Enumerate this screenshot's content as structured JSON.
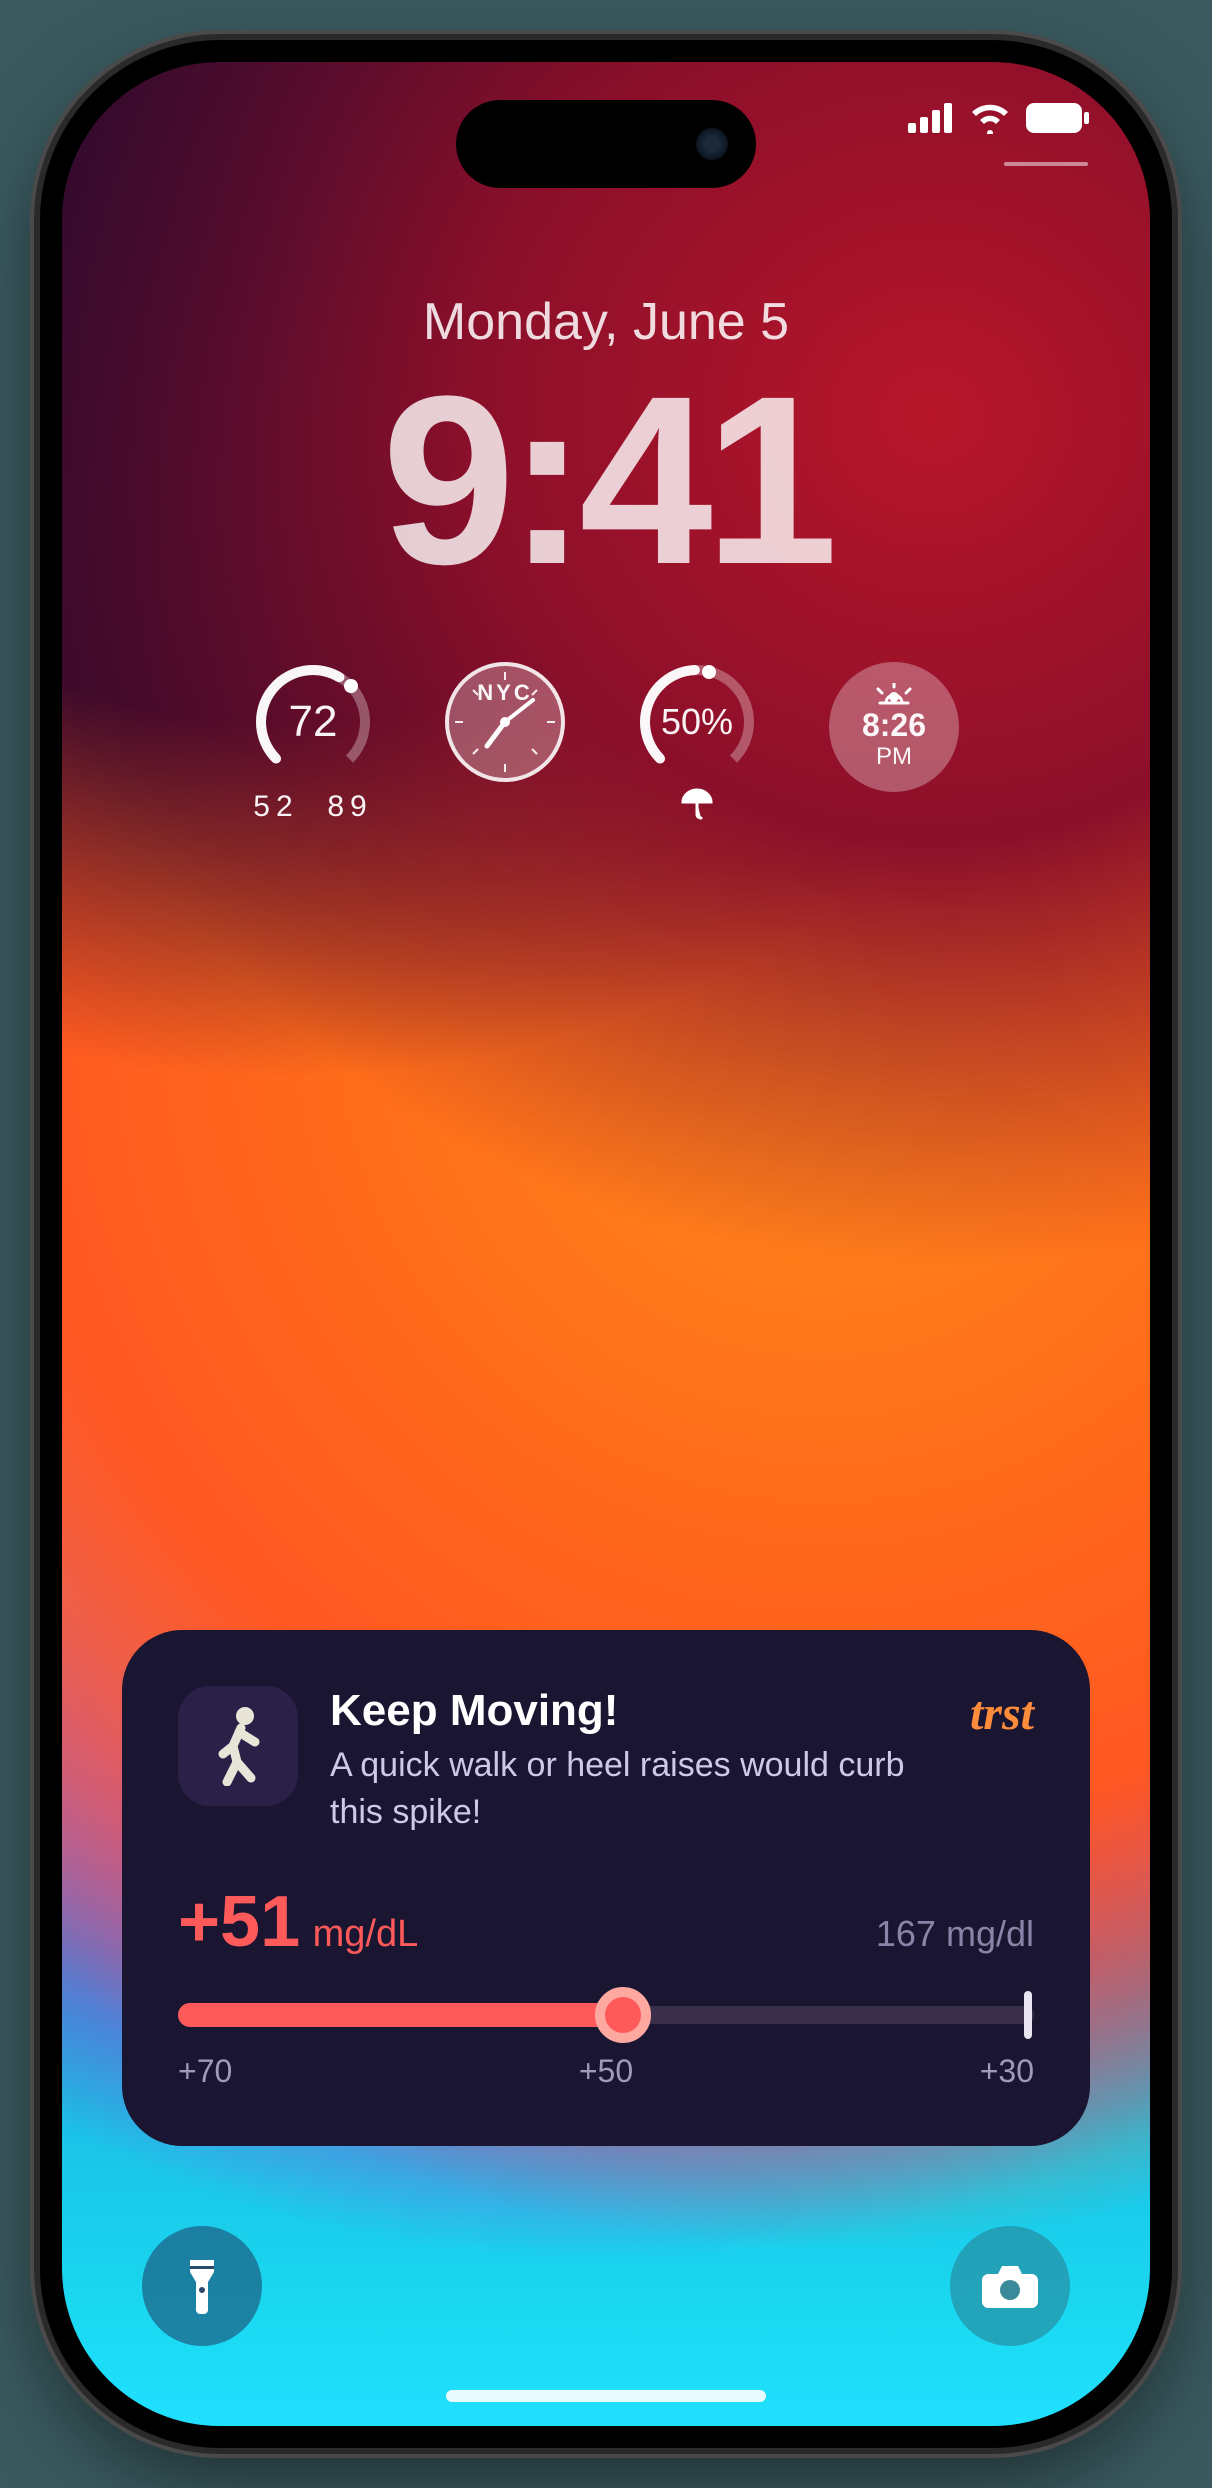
{
  "status": {
    "date": "Monday, June 5",
    "time": "9:41"
  },
  "widgets": {
    "weather": {
      "temp": "72",
      "low": "52",
      "high": "89"
    },
    "clock": {
      "city": "NYC"
    },
    "precip": {
      "value": "50%"
    },
    "sun": {
      "time": "8:26",
      "period": "PM"
    }
  },
  "notification": {
    "brand": "trst",
    "title": "Keep Moving!",
    "body": "A quick walk or heel raises would curb this spike!",
    "delta": "+51",
    "unit": "mg/dL",
    "current": "167 mg/dl",
    "slider": {
      "left": "+70",
      "mid": "+50",
      "right": "+30",
      "fill_percent": 52
    }
  }
}
